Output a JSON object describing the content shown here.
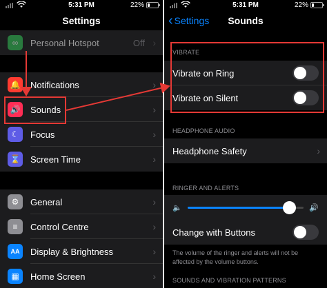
{
  "left": {
    "status": {
      "time": "5:31 PM",
      "battery": "22%",
      "battery_level": 0.22
    },
    "title": "Settings",
    "rows": [
      {
        "label": "Personal Hotspot",
        "value": "Off",
        "icon": "hotspot-icon",
        "color": "#34c759"
      },
      {
        "label": "Notifications",
        "icon": "bell-icon",
        "color": "#ff3b30"
      },
      {
        "label": "Sounds",
        "icon": "speaker-icon",
        "color": "#ff2d55"
      },
      {
        "label": "Focus",
        "icon": "moon-icon",
        "color": "#5e5ce6"
      },
      {
        "label": "Screen Time",
        "icon": "hourglass-icon",
        "color": "#5e5ce6"
      },
      {
        "label": "General",
        "icon": "gear-icon",
        "color": "#8e8e93"
      },
      {
        "label": "Control Centre",
        "icon": "toggles-icon",
        "color": "#8e8e93"
      },
      {
        "label": "Display & Brightness",
        "icon": "aa-icon",
        "color": "#0a84ff"
      },
      {
        "label": "Home Screen",
        "icon": "grid-icon",
        "color": "#0a84ff"
      }
    ],
    "icon_glyphs": {
      "bell": "🔔",
      "speaker": "🔊",
      "moon": "☾",
      "hourglass": "⌛",
      "gear": "⚙",
      "toggles": "≡",
      "aa": "AA",
      "grid": "▦",
      "hotspot": "∞"
    }
  },
  "right": {
    "status": {
      "time": "5:31 PM",
      "battery": "22%",
      "battery_level": 0.22
    },
    "back_label": "Settings",
    "title": "Sounds",
    "vibrate_header": "VIBRATE",
    "vibrate_on_ring": {
      "label": "Vibrate on Ring",
      "on": false
    },
    "vibrate_on_silent": {
      "label": "Vibrate on Silent",
      "on": false
    },
    "headphone_header": "HEADPHONE AUDIO",
    "headphone_safety": "Headphone Safety",
    "ringer_header": "RINGER AND ALERTS",
    "ringer_volume": 0.88,
    "change_with_buttons": {
      "label": "Change with Buttons",
      "on": false
    },
    "ringer_note": "The volume of the ringer and alerts will not be affected by the volume buttons.",
    "patterns_header": "SOUNDS AND VIBRATION PATTERNS"
  },
  "colors": {
    "accent": "#0a84ff",
    "highlight": "#e53935"
  }
}
